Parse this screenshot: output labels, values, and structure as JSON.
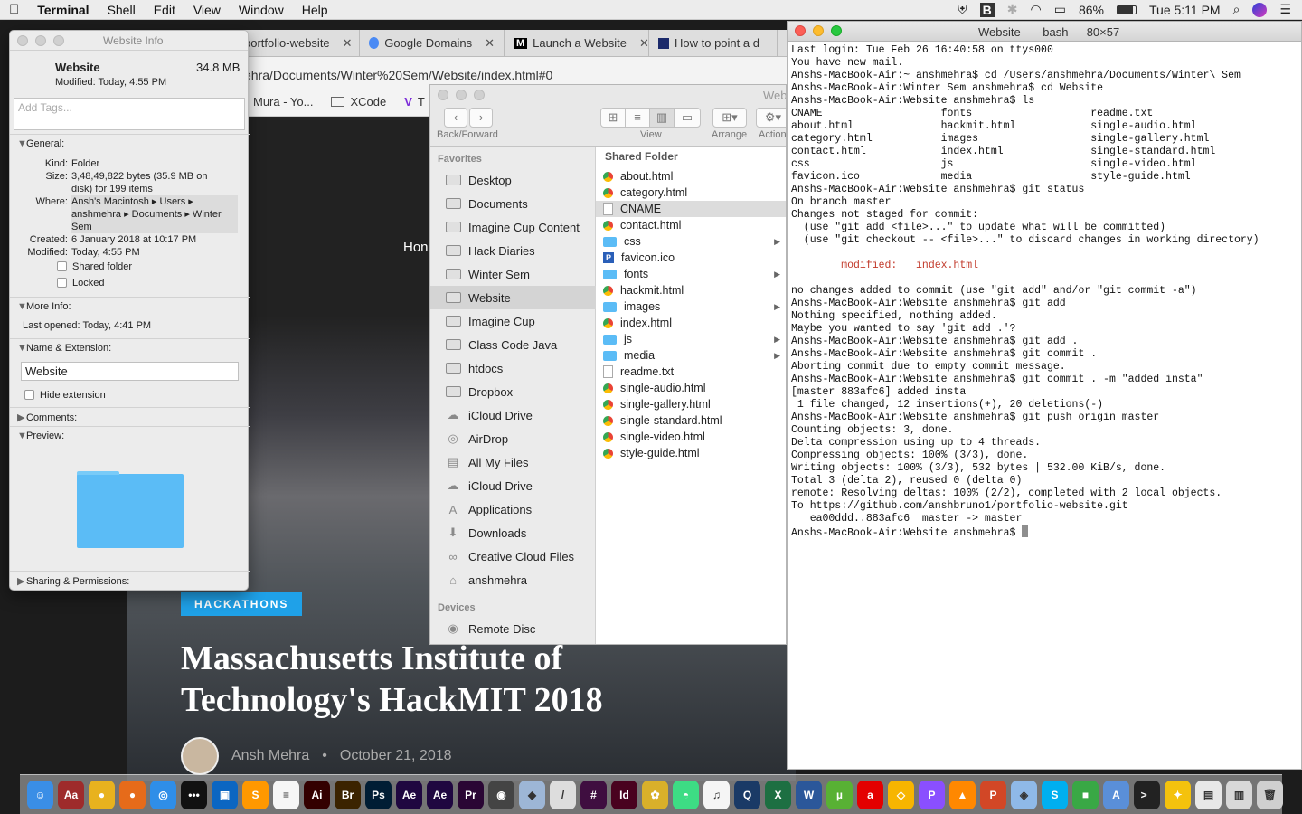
{
  "menubar": {
    "apple": "",
    "app": "Terminal",
    "menus": [
      "Shell",
      "Edit",
      "View",
      "Window",
      "Help"
    ],
    "battery": "86%",
    "clock": "Tue 5:11 PM"
  },
  "browser": {
    "tabs": [
      {
        "title": "portfolio-website"
      },
      {
        "title": "Google Domains"
      },
      {
        "title": "Launch a Website"
      },
      {
        "title": "How to point a d"
      }
    ],
    "tab_close": "✕",
    "url": "ehra/Documents/Winter%20Sem/Website/index.html#0",
    "bookmarks": [
      "Mura - Yo...",
      "XCode",
      "T"
    ],
    "nav_home": "Hon",
    "badge": "HACKATHONS",
    "post_title": "Massachusetts Institute of Technology's HackMIT 2018",
    "author": "Ansh Mehra",
    "meta_sep": "•",
    "date": "October 21, 2018"
  },
  "info": {
    "title": "Website Info",
    "name": "Website",
    "size": "34.8 MB",
    "modified_line": "Modified: Today, 4:55 PM",
    "tags_placeholder": "Add Tags...",
    "general": {
      "heading": "General:",
      "kind_label": "Kind:",
      "kind": "Folder",
      "size_label": "Size:",
      "size": "3,48,49,822 bytes (35.9 MB on disk) for 199 items",
      "where_label": "Where:",
      "where": "Ansh's Macintosh ▸ Users ▸ anshmehra ▸ Documents ▸ Winter Sem",
      "created_label": "Created:",
      "created": "6 January 2018 at 10:17 PM",
      "modified_label": "Modified:",
      "modified": "Today, 4:55 PM",
      "shared": "Shared folder",
      "locked": "Locked"
    },
    "more_info": {
      "heading": "More Info:",
      "last_opened": "Last opened: Today, 4:41 PM"
    },
    "name_ext": {
      "heading": "Name & Extension:",
      "value": "Website",
      "hide_ext": "Hide extension"
    },
    "comments": "Comments:",
    "preview": "Preview:",
    "sharing": "Sharing & Permissions:"
  },
  "finder": {
    "title": "Website",
    "back_forward": "Back/Forward",
    "view": "View",
    "arrange": "Arrange",
    "action": "Action",
    "favorites_heading": "Favorites",
    "favorites": [
      {
        "label": "Desktop",
        "icon": "folder-icon"
      },
      {
        "label": "Documents",
        "icon": "folder-icon"
      },
      {
        "label": "Imagine Cup Content",
        "icon": "folder-icon"
      },
      {
        "label": "Hack Diaries",
        "icon": "folder-icon"
      },
      {
        "label": "Winter Sem",
        "icon": "folder-icon"
      },
      {
        "label": "Website",
        "icon": "folder-icon",
        "selected": true
      },
      {
        "label": "Imagine Cup",
        "icon": "folder-icon"
      },
      {
        "label": "Class Code Java",
        "icon": "folder-icon"
      },
      {
        "label": "htdocs",
        "icon": "folder-icon"
      },
      {
        "label": "Dropbox",
        "icon": "folder-icon"
      },
      {
        "label": "iCloud Drive",
        "icon": "cloud-icon"
      },
      {
        "label": "AirDrop",
        "icon": "airdrop-icon"
      },
      {
        "label": "All My Files",
        "icon": "files-icon"
      },
      {
        "label": "iCloud Drive",
        "icon": "cloud-icon"
      },
      {
        "label": "Applications",
        "icon": "apps-icon"
      },
      {
        "label": "Downloads",
        "icon": "download-icon"
      },
      {
        "label": "Creative Cloud Files",
        "icon": "cc-icon"
      },
      {
        "label": "anshmehra",
        "icon": "home-icon"
      }
    ],
    "devices_heading": "Devices",
    "devices": [
      {
        "label": "Remote Disc",
        "icon": "disc-icon"
      }
    ],
    "list_heading": "Shared Folder",
    "files": [
      {
        "name": "about.html",
        "type": "html"
      },
      {
        "name": "category.html",
        "type": "html"
      },
      {
        "name": "CNAME",
        "type": "doc",
        "selected": true
      },
      {
        "name": "contact.html",
        "type": "html"
      },
      {
        "name": "css",
        "type": "dir"
      },
      {
        "name": "favicon.ico",
        "type": "ico"
      },
      {
        "name": "fonts",
        "type": "dir"
      },
      {
        "name": "hackmit.html",
        "type": "html"
      },
      {
        "name": "images",
        "type": "dir"
      },
      {
        "name": "index.html",
        "type": "html"
      },
      {
        "name": "js",
        "type": "dir"
      },
      {
        "name": "media",
        "type": "dir"
      },
      {
        "name": "readme.txt",
        "type": "doc"
      },
      {
        "name": "single-audio.html",
        "type": "html"
      },
      {
        "name": "single-gallery.html",
        "type": "html"
      },
      {
        "name": "single-standard.html",
        "type": "html"
      },
      {
        "name": "single-video.html",
        "type": "html"
      },
      {
        "name": "style-guide.html",
        "type": "html"
      }
    ]
  },
  "terminal": {
    "title": "Website — -bash — 80×57",
    "lines": [
      "Last login: Tue Feb 26 16:40:58 on ttys000",
      "You have new mail.",
      "Anshs-MacBook-Air:~ anshmehra$ cd /Users/anshmehra/Documents/Winter\\ Sem",
      "Anshs-MacBook-Air:Winter Sem anshmehra$ cd Website",
      "Anshs-MacBook-Air:Website anshmehra$ ls",
      "CNAME                   fonts                   readme.txt",
      "about.html              hackmit.html            single-audio.html",
      "category.html           images                  single-gallery.html",
      "contact.html            index.html              single-standard.html",
      "css                     js                      single-video.html",
      "favicon.ico             media                   style-guide.html",
      "Anshs-MacBook-Air:Website anshmehra$ git status",
      "On branch master",
      "Changes not staged for commit:",
      "  (use \"git add <file>...\" to update what will be committed)",
      "  (use \"git checkout -- <file>...\" to discard changes in working directory)",
      "",
      "        modified:   index.html",
      "",
      "no changes added to commit (use \"git add\" and/or \"git commit -a\")",
      "Anshs-MacBook-Air:Website anshmehra$ git add",
      "Nothing specified, nothing added.",
      "Maybe you wanted to say 'git add .'?",
      "Anshs-MacBook-Air:Website anshmehra$ git add .",
      "Anshs-MacBook-Air:Website anshmehra$ git commit .",
      "Aborting commit due to empty commit message.",
      "Anshs-MacBook-Air:Website anshmehra$ git commit . -m \"added insta\"",
      "[master 883afc6] added insta",
      " 1 file changed, 12 insertions(+), 20 deletions(-)",
      "Anshs-MacBook-Air:Website anshmehra$ git push origin master",
      "Counting objects: 3, done.",
      "Delta compression using up to 4 threads.",
      "Compressing objects: 100% (3/3), done.",
      "Writing objects: 100% (3/3), 532 bytes | 532.00 KiB/s, done.",
      "Total 3 (delta 2), reused 0 (delta 0)",
      "remote: Resolving deltas: 100% (2/2), completed with 2 local objects.",
      "To https://github.com/anshbruno1/portfolio-website.git",
      "   ea00ddd..883afc6  master -> master",
      "Anshs-MacBook-Air:Website anshmehra$ "
    ],
    "red_line_index": 17
  },
  "dock": {
    "apps": [
      {
        "name": "finder",
        "label": "☺",
        "color": "#3a8ee6"
      },
      {
        "name": "dictionary",
        "label": "Aa",
        "color": "#9e2b2b"
      },
      {
        "name": "chrome",
        "label": "●",
        "color": "#e8b21e"
      },
      {
        "name": "firefox",
        "label": "●",
        "color": "#e66b1a"
      },
      {
        "name": "safari",
        "label": "◎",
        "color": "#2f8ee8"
      },
      {
        "name": "app-dots",
        "label": "•••",
        "color": "#111"
      },
      {
        "name": "codesandbox",
        "label": "▣",
        "color": "#0b66c2"
      },
      {
        "name": "sublime",
        "label": "S",
        "color": "#ff9800"
      },
      {
        "name": "notes",
        "label": "≡",
        "color": "#f6f6f6"
      },
      {
        "name": "illustrator",
        "label": "Ai",
        "color": "#330000"
      },
      {
        "name": "bridge",
        "label": "Br",
        "color": "#3b2300"
      },
      {
        "name": "photoshop",
        "label": "Ps",
        "color": "#001d34"
      },
      {
        "name": "after-effects",
        "label": "Ae",
        "color": "#1f0740"
      },
      {
        "name": "after-effects-2",
        "label": "Ae",
        "color": "#1f0740"
      },
      {
        "name": "premiere",
        "label": "Pr",
        "color": "#2a0634"
      },
      {
        "name": "sequel",
        "label": "◉",
        "color": "#444"
      },
      {
        "name": "box",
        "label": "◆",
        "color": "#9db6d6"
      },
      {
        "name": "quill",
        "label": "/",
        "color": "#ddd"
      },
      {
        "name": "slack",
        "label": "#",
        "color": "#3f0e40"
      },
      {
        "name": "indesign",
        "label": "Id",
        "color": "#49021f"
      },
      {
        "name": "pineapple",
        "label": "✿",
        "color": "#d9b02a"
      },
      {
        "name": "android",
        "label": "◓",
        "color": "#3ddc84"
      },
      {
        "name": "itunes",
        "label": "♫",
        "color": "#f5f5f5"
      },
      {
        "name": "quicktime",
        "label": "Q",
        "color": "#1a3a66"
      },
      {
        "name": "excel",
        "label": "X",
        "color": "#1d6f42"
      },
      {
        "name": "word",
        "label": "W",
        "color": "#2b579a"
      },
      {
        "name": "torrent",
        "label": "µ",
        "color": "#58b134"
      },
      {
        "name": "airtel",
        "label": "a",
        "color": "#e40000"
      },
      {
        "name": "sketch",
        "label": "◇",
        "color": "#f7b500"
      },
      {
        "name": "paw",
        "label": "P",
        "color": "#8a4fff"
      },
      {
        "name": "transmit",
        "label": "▲",
        "color": "#ff8800"
      },
      {
        "name": "powerpoint",
        "label": "P",
        "color": "#d24726"
      },
      {
        "name": "preview",
        "label": "◈",
        "color": "#8fb9e8"
      },
      {
        "name": "skype",
        "label": "S",
        "color": "#00aff0"
      },
      {
        "name": "colors",
        "label": "■",
        "color": "#39a845"
      },
      {
        "name": "app-store-badge",
        "label": "A",
        "color": "#5a8fd8"
      },
      {
        "name": "terminal",
        "label": ">_",
        "color": "#222"
      },
      {
        "name": "bulb",
        "label": "✦",
        "color": "#f4c20d"
      },
      {
        "name": "documents",
        "label": "▤",
        "color": "#e8e8e8"
      },
      {
        "name": "downloads-stack",
        "label": "▥",
        "color": "#d8d8d8"
      },
      {
        "name": "trash",
        "label": "🗑",
        "color": "#cfcfcf"
      }
    ]
  }
}
